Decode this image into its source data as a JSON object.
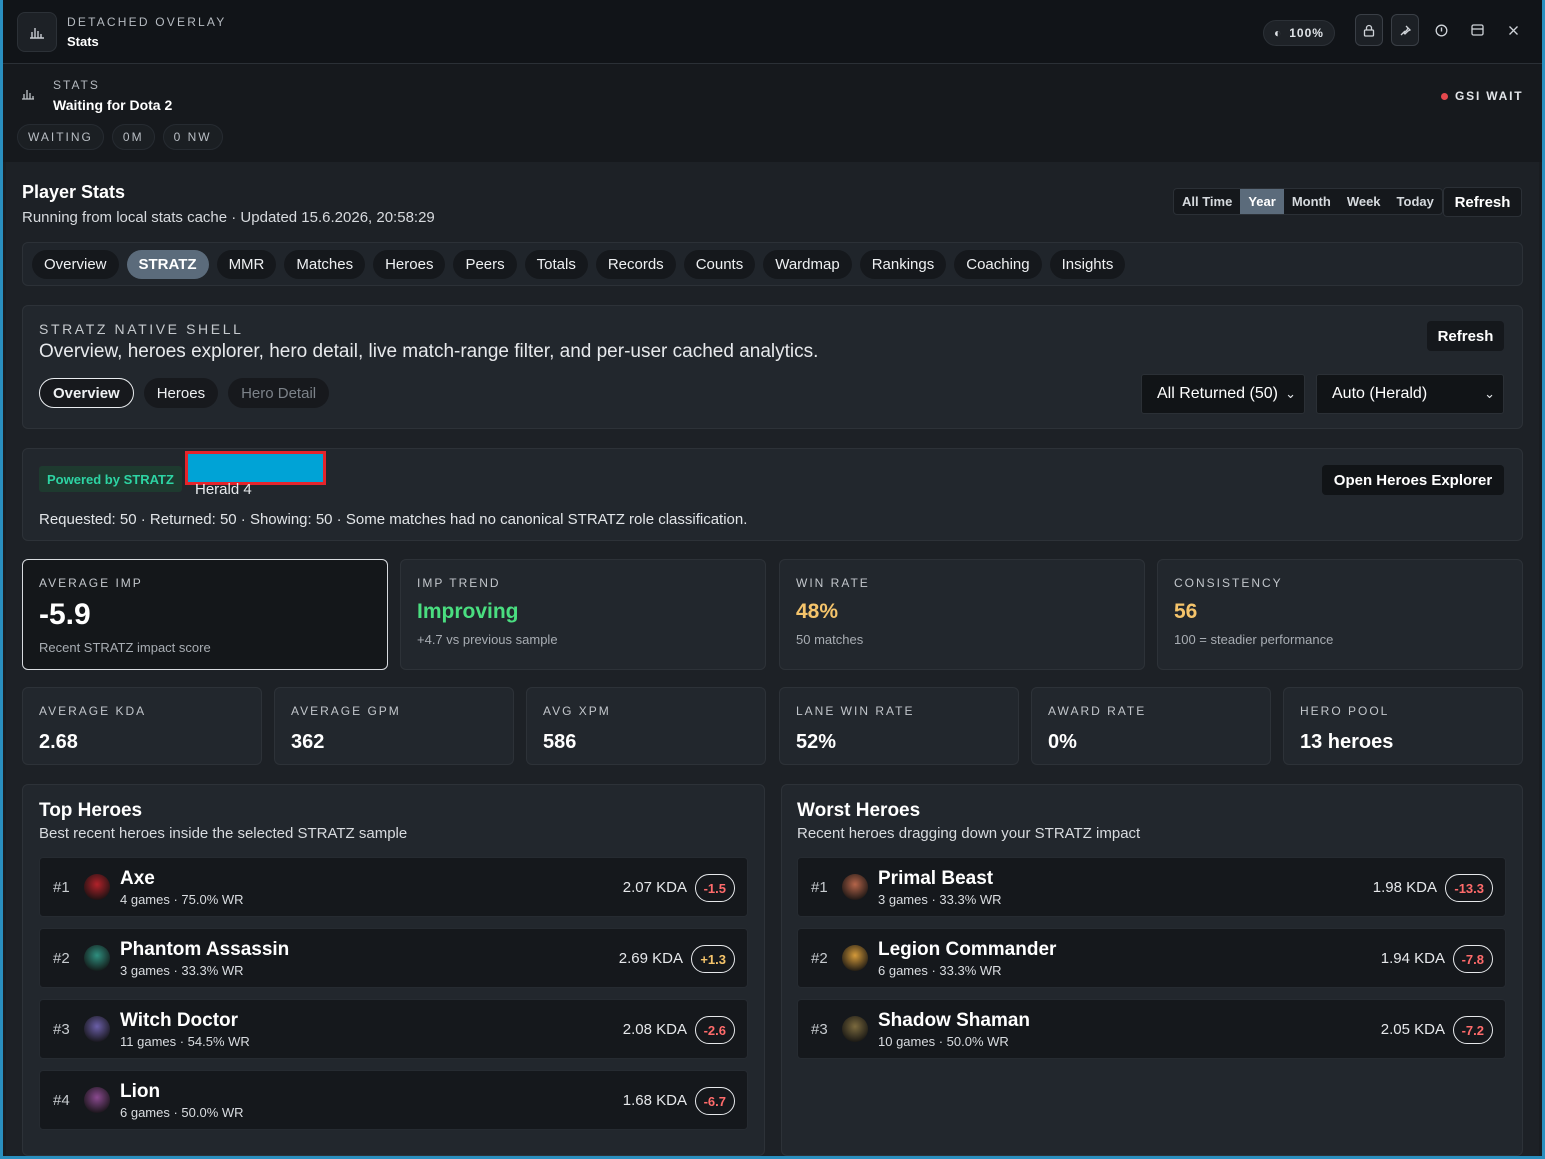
{
  "titlebar": {
    "overline": "DETACHED OVERLAY",
    "title": "Stats",
    "opacity": "100%"
  },
  "header": {
    "overline": "STATS",
    "title": "Waiting for Dota 2",
    "gsi_status": "GSI WAIT",
    "chips": [
      "WAITING",
      "0M",
      "0 NW"
    ]
  },
  "player_stats": {
    "title": "Player Stats",
    "subtitle": "Running from local stats cache · Updated 15.6.2026, 20:58:29",
    "ranges": [
      "All Time",
      "Year",
      "Month",
      "Week",
      "Today"
    ],
    "active_range": "Year",
    "refresh": "Refresh"
  },
  "tabs": [
    "Overview",
    "STRATZ",
    "MMR",
    "Matches",
    "Heroes",
    "Peers",
    "Totals",
    "Records",
    "Counts",
    "Wardmap",
    "Rankings",
    "Coaching",
    "Insights"
  ],
  "active_tab": "STRATZ",
  "stratz_shell": {
    "overline": "STRATZ NATIVE SHELL",
    "description": "Overview, heroes explorer, hero detail, live match-range filter, and per-user cached analytics.",
    "refresh": "Refresh",
    "subtabs": [
      "Overview",
      "Heroes",
      "Hero Detail"
    ],
    "filter_matches": "All Returned (50)",
    "filter_rank": "Auto (Herald)"
  },
  "profile": {
    "badge": "Powered by STRATZ",
    "rank": "Herald 4",
    "open_explorer": "Open Heroes Explorer",
    "request_summary": "Requested: 50 · Returned: 50 · Showing: 50 · Some matches had no canonical STRATZ role classification."
  },
  "kpis": [
    {
      "label": "AVERAGE IMP",
      "value": "-5.9",
      "sub": "Recent STRATZ impact score",
      "color": "#ffffff"
    },
    {
      "label": "IMP TREND",
      "value": "Improving",
      "sub": "+4.7 vs previous sample",
      "color": "#4ade80"
    },
    {
      "label": "WIN RATE",
      "value": "48%",
      "sub": "50 matches",
      "color": "#f5c46b"
    },
    {
      "label": "CONSISTENCY",
      "value": "56",
      "sub": "100 = steadier performance",
      "color": "#f5c46b"
    }
  ],
  "stats": [
    {
      "label": "AVERAGE KDA",
      "value": "2.68"
    },
    {
      "label": "AVERAGE GPM",
      "value": "362"
    },
    {
      "label": "AVG XPM",
      "value": "586"
    },
    {
      "label": "LANE WIN RATE",
      "value": "52%"
    },
    {
      "label": "AWARD RATE",
      "value": "0%"
    },
    {
      "label": "HERO POOL",
      "value": "13 heroes"
    }
  ],
  "top_heroes": {
    "title": "Top Heroes",
    "subtitle": "Best recent heroes inside the selected STRATZ sample",
    "rows": [
      {
        "rank": "#1",
        "name": "Axe",
        "meta": "4 games · 75.0% WR",
        "kda": "2.07 KDA",
        "delta": "-1.5",
        "delta_color": "#ff6b6b",
        "avatar": "#b2222a"
      },
      {
        "rank": "#2",
        "name": "Phantom Assassin",
        "meta": "3 games · 33.3% WR",
        "kda": "2.69 KDA",
        "delta": "+1.3",
        "delta_color": "#f5c46b",
        "avatar": "#2f8f7f"
      },
      {
        "rank": "#3",
        "name": "Witch Doctor",
        "meta": "11 games · 54.5% WR",
        "kda": "2.08 KDA",
        "delta": "-2.6",
        "delta_color": "#ff6b6b",
        "avatar": "#6b5fa8"
      },
      {
        "rank": "#4",
        "name": "Lion",
        "meta": "6 games · 50.0% WR",
        "kda": "1.68 KDA",
        "delta": "-6.7",
        "delta_color": "#ff6b6b",
        "avatar": "#8a4a8f"
      }
    ]
  },
  "worst_heroes": {
    "title": "Worst Heroes",
    "subtitle": "Recent heroes dragging down your STRATZ impact",
    "rows": [
      {
        "rank": "#1",
        "name": "Primal Beast",
        "meta": "3 games · 33.3% WR",
        "kda": "1.98 KDA",
        "delta": "-13.3",
        "delta_color": "#ff6b6b",
        "avatar": "#b5654a"
      },
      {
        "rank": "#2",
        "name": "Legion Commander",
        "meta": "6 games · 33.3% WR",
        "kda": "1.94 KDA",
        "delta": "-7.8",
        "delta_color": "#ff6b6b",
        "avatar": "#d49a3a"
      },
      {
        "rank": "#3",
        "name": "Shadow Shaman",
        "meta": "10 games · 50.0% WR",
        "kda": "2.05 KDA",
        "delta": "-7.2",
        "delta_color": "#ff6b6b",
        "avatar": "#7b6a3e"
      }
    ]
  }
}
